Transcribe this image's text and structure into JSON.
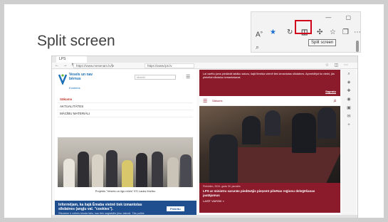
{
  "slide": {
    "title": "Split screen"
  },
  "zoom": {
    "window_controls": "— ▢",
    "tooltip": "Split screen",
    "tool_icons": [
      "read-aloud-icon",
      "favorite-icon",
      "refresh-icon",
      "split-screen-icon",
      "extensions-icon",
      "favorites-bar-icon",
      "collections-icon",
      "more-icon"
    ]
  },
  "browser": {
    "tab_label": "LPS",
    "left_url": "https://www.mesenam.lv/lv",
    "right_url": "https://www.lps.lv",
    "left": {
      "logo_text": "Vesels un nav bērnus",
      "logo_sub": "Konteins",
      "search_placeholder": "Meklēt",
      "menu": [
        "Sākums",
        "AKTUALITĀTES",
        "MĀCĪBU MATERIĀLI"
      ],
      "caption": "Projekts \"Vesels un ilgs mūžs\" ES Lauks līdzību",
      "cookie_title": "Informējam, ka šajā Ēmaba vietnē tiek izmantotas sīkdatnes (angļu val. \"cookies\").",
      "cookie_body": "Sīkdatne ir neliels teksta fails, kas tiek saglabāts jūsu datorā. Tās palīdz nodrošināt vietnes darbību un uzlabot lietošanas pieredzi. Plašāka informācija par sīkdatnēm.",
      "cookie_button": "Piekrītu"
    },
    "right": {
      "banner_text": "Lai varētu jums piedāvāt labāku saturu, šajā tīmekļa vietnē tiek izmantotas sīkdatnes. Apmeklējot šo vietni, jūs piekrītat sīkdatņu izmantošanai.",
      "banner_ok": "Sapratu",
      "nav_label": "Sākums",
      "news_date": "Piektdien, 2024. gada 30. janvāris",
      "news_headline": "LPS ar ministru sarunās piedāvājis pieņemt pilsētas reģionu deleģēšanas jautājumus",
      "news_more": "LASĪT VAIRĀK »"
    }
  }
}
